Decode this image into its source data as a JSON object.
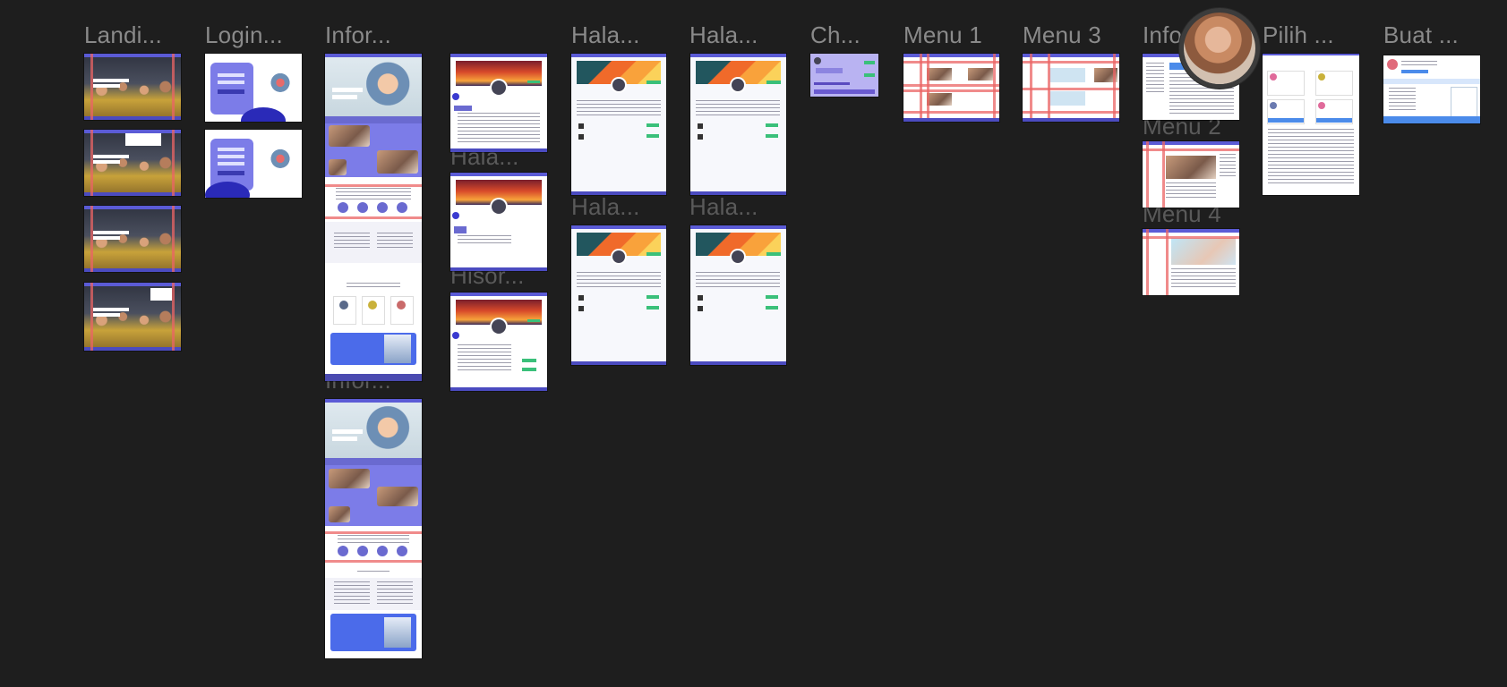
{
  "canvas": {
    "background": "#1e1e1e"
  },
  "frame_labels": {
    "landing": "Landi...",
    "login": "Login...",
    "info_1": "Infor...",
    "info_2": "Infor...",
    "hala_1": "Hala...",
    "hala_2": "Hala...",
    "hala_3": "Hala...",
    "hala_4": "Hala...",
    "hala_5": "Hala...",
    "hisor": "Hisor...",
    "ch": "Ch...",
    "menu_1": "Menu 1",
    "menu_3": "Menu 3",
    "info_3": "Info",
    "menu_2": "Menu 2",
    "menu_4": "Menu 4",
    "pilih": "Pilih ...",
    "buat": "Buat ..."
  },
  "collaborator": {
    "avatar": "user-avatar"
  },
  "colors": {
    "accent": "#5b5bd6",
    "guide_lines": "#eb6464",
    "label_text": "#8a8a8a"
  }
}
